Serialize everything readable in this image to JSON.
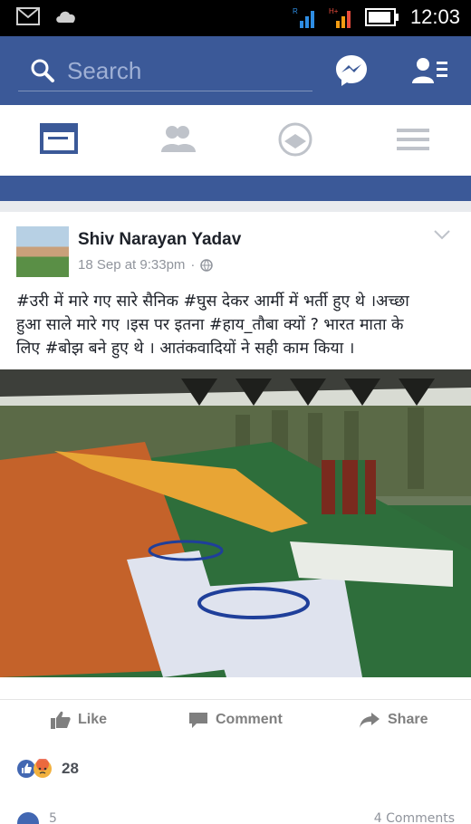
{
  "status_bar": {
    "time": "12:03",
    "icons": [
      "gmail-icon",
      "cloud-icon",
      "signal-icon",
      "hplus-signal-icon",
      "battery-icon"
    ]
  },
  "top_bar": {
    "search_placeholder": "Search",
    "icons": [
      "search-icon",
      "messenger-icon",
      "friend-requests-icon"
    ]
  },
  "tabs": [
    "news-feed-tab",
    "friends-tab",
    "notifications-tab",
    "menu-tab"
  ],
  "post": {
    "author": "Shiv Narayan Yadav",
    "time": "18 Sep at 9:33pm",
    "privacy_icon": "globe-icon",
    "text_lines": [
      "#उरी में मारे गए सारे सैनिक #घुस देकर आर्मी में भर्ती हुए थे ।अच्छा",
      "हुआ साले मारे गए ।इस पर इतना #हाय_तौबा क्यों ? भारत माता के",
      "लिए  #बोझ बने हुए थे । आतंकवादियों ने सही काम किया ।"
    ],
    "photo_desc": "Coffins draped in flags with wreaths, soldiers standing in background",
    "actions": {
      "like": "Like",
      "comment": "Comment",
      "share": "Share"
    },
    "reaction_count": "28",
    "share_count": "5",
    "comments_label": "4 Comments"
  },
  "colors": {
    "brand_blue": "#3b5998",
    "text_dark": "#1d2129",
    "muted": "#90949c"
  }
}
